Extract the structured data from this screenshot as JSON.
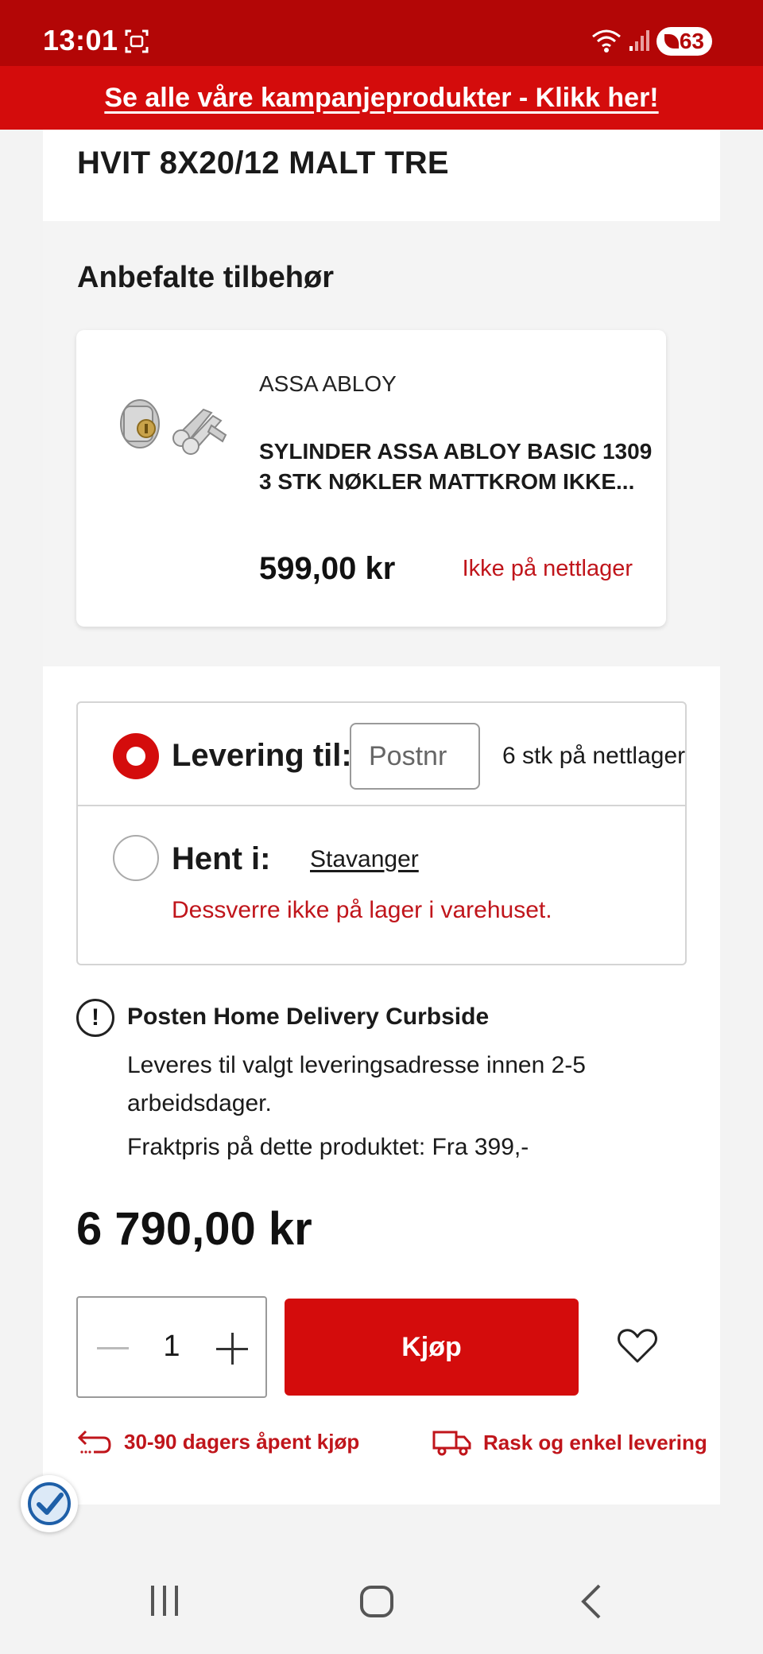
{
  "status_bar": {
    "time": "13:01",
    "battery": "63"
  },
  "promo": {
    "text": "Se alle våre kampanjeprodukter - Klikk her!"
  },
  "product": {
    "title": "HVIT 8X20/12 MALT TRE"
  },
  "accessories": {
    "title": "Anbefalte tilbehør",
    "item": {
      "brand": "ASSA ABLOY",
      "name": "SYLINDER ASSA ABLOY BASIC 1309 3 STK NØKLER MATTKROM IKKE...",
      "price": "599,00 kr",
      "stock": "Ikke på nettlager"
    }
  },
  "delivery": {
    "label": "Levering til:",
    "postnr_placeholder": "Postnr",
    "stock": "6 stk på nettlager",
    "pickup_label": "Hent i:",
    "pickup_store": "Stavanger",
    "pickup_note": "Dessverre ikke på lager i varehuset."
  },
  "shipping": {
    "title": "Posten Home Delivery Curbside",
    "description": "Leveres til valgt leveringsadresse innen 2-5 arbeidsdager.",
    "freight": "Fraktpris på dette produktet: Fra 399,-"
  },
  "price": "6 790,00 kr",
  "quantity": "1",
  "buy_label": "Kjøp",
  "perks": {
    "return": "30-90 dagers åpent kjøp",
    "delivery": "Rask og enkel levering"
  },
  "colors": {
    "brand_red": "#d40c0c",
    "status_red": "#b30606",
    "error_red": "#c0151b"
  }
}
